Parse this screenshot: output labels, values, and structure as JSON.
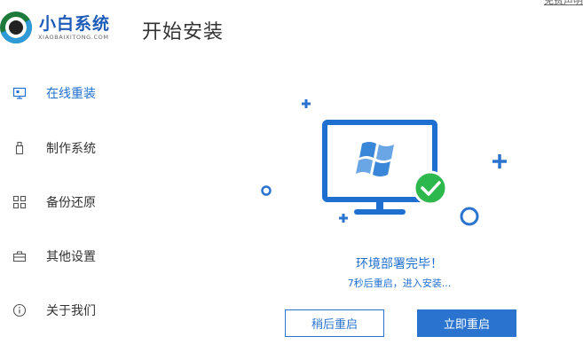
{
  "app": {
    "logo_name": "小白系统",
    "logo_subtitle": "XIAOBAIXITONG.COM",
    "page_title": "开始安装",
    "top_link": "免费声明"
  },
  "sidebar": {
    "items": [
      {
        "label": "在线重装",
        "icon": "monitor-icon",
        "active": true
      },
      {
        "label": "制作系统",
        "icon": "usb-drive-icon",
        "active": false
      },
      {
        "label": "备份还原",
        "icon": "backup-grid-icon",
        "active": false
      },
      {
        "label": "其他设置",
        "icon": "toolbox-icon",
        "active": false
      },
      {
        "label": "关于我们",
        "icon": "info-icon",
        "active": false
      }
    ]
  },
  "main": {
    "status": "环境部署完毕！",
    "countdown": "7秒后重启，进入安装...",
    "restart_later_label": "稍后重启",
    "restart_now_label": "立即重启"
  },
  "colors": {
    "brand_blue": "#1f6fd1",
    "button_blue": "#2a74d0",
    "check_green": "#2db84d"
  }
}
